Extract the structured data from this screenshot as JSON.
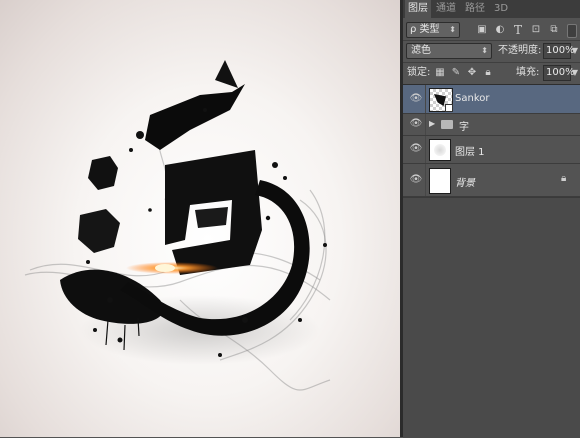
{
  "tabs": [
    {
      "label": "图层",
      "active": true
    },
    {
      "label": "通道",
      "active": false
    },
    {
      "label": "路径",
      "active": false
    },
    {
      "label": "3D",
      "active": false
    }
  ],
  "filter": {
    "kind_label": "ρ 类型",
    "icons": [
      "image-filter-icon",
      "adjustment-filter-icon",
      "type-filter-icon",
      "shape-filter-icon",
      "smart-object-filter-icon"
    ]
  },
  "blend": {
    "mode": "滤色",
    "opacity_label": "不透明度:",
    "opacity_value": "100%"
  },
  "lock": {
    "label": "锁定:",
    "fill_label": "填充:",
    "fill_value": "100%"
  },
  "layers": [
    {
      "name": "Sankor",
      "type": "smart-object",
      "selected": true
    },
    {
      "name": "字",
      "type": "group",
      "selected": false
    },
    {
      "name": "图层 1",
      "type": "layer",
      "selected": false
    },
    {
      "name": "背景",
      "type": "background",
      "selected": false,
      "locked": true
    }
  ],
  "colors": {
    "panel_bg": "#535353",
    "selected_layer": "#586880",
    "tab_bar": "#3c3c3c"
  }
}
